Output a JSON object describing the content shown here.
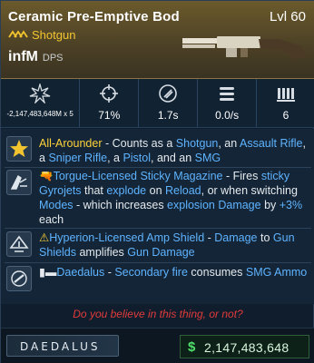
{
  "item": {
    "name": "Ceramic Pre-Emptive Bod",
    "level": "Lvl 60",
    "type": "Shotgun",
    "rarity_icon": "chevrons",
    "dps_value": "infM",
    "dps_label": "DPS"
  },
  "stats": [
    {
      "icon": "damage-burst-icon",
      "value": "-2,147,483,648M x 5"
    },
    {
      "icon": "crosshair-icon",
      "value": "71%"
    },
    {
      "icon": "reload-icon",
      "value": "1.7s"
    },
    {
      "icon": "fire-rate-icon",
      "value": "0.0/s"
    },
    {
      "icon": "magazine-icon",
      "value": "6"
    }
  ],
  "perks": [
    {
      "icon": "star-perk-icon",
      "parts": [
        {
          "t": "All-Arounder",
          "c": "hl"
        },
        {
          "t": " - Counts as a ",
          "c": ""
        },
        {
          "t": "Shotgun",
          "c": "bl"
        },
        {
          "t": ", an ",
          "c": ""
        },
        {
          "t": "Assault Rifle",
          "c": "bl"
        },
        {
          "t": ", a ",
          "c": ""
        },
        {
          "t": "Sniper Rifle",
          "c": "bl"
        },
        {
          "t": ", a ",
          "c": ""
        },
        {
          "t": "Pistol",
          "c": "bl"
        },
        {
          "t": ", and an ",
          "c": ""
        },
        {
          "t": "SMG",
          "c": "bl"
        }
      ]
    },
    {
      "icon": "sticky-magazine-icon",
      "parts": [
        {
          "t": "🔫",
          "c": ""
        },
        {
          "t": "Torgue-Licensed Sticky Magazine",
          "c": "bl"
        },
        {
          "t": " - Fires ",
          "c": ""
        },
        {
          "t": "sticky Gyrojets",
          "c": "bl"
        },
        {
          "t": " that ",
          "c": ""
        },
        {
          "t": "explode",
          "c": "bl"
        },
        {
          "t": " on ",
          "c": ""
        },
        {
          "t": "Reload",
          "c": "bl"
        },
        {
          "t": ", or when switching ",
          "c": ""
        },
        {
          "t": "Modes",
          "c": "bl"
        },
        {
          "t": " - which increases ",
          "c": ""
        },
        {
          "t": "explosion Damage",
          "c": "bl"
        },
        {
          "t": " by ",
          "c": ""
        },
        {
          "t": "+3%",
          "c": "bl"
        },
        {
          "t": " each",
          "c": ""
        }
      ]
    },
    {
      "icon": "amp-shield-icon",
      "parts": [
        {
          "t": "⚠",
          "c": "hl"
        },
        {
          "t": "Hyperion-Licensed Amp Shield",
          "c": "bl"
        },
        {
          "t": " - ",
          "c": ""
        },
        {
          "t": "Damage",
          "c": "bl"
        },
        {
          "t": " to ",
          "c": ""
        },
        {
          "t": "Gun Shields",
          "c": "bl"
        },
        {
          "t": " amplifies ",
          "c": ""
        },
        {
          "t": "Gun Damage",
          "c": "bl"
        }
      ]
    },
    {
      "icon": "secondary-fire-icon",
      "parts": [
        {
          "t": "▮▬",
          "c": ""
        },
        {
          "t": "Daedalus",
          "c": "bl"
        },
        {
          "t": " - ",
          "c": ""
        },
        {
          "t": "Secondary fire",
          "c": "bl"
        },
        {
          "t": " consumes ",
          "c": ""
        },
        {
          "t": "SMG Ammo",
          "c": "bl"
        }
      ]
    }
  ],
  "flavor": "Do you believe in this thing, or not?",
  "manufacturer": "DAEDALUS",
  "price": {
    "symbol": "$",
    "value": "2,147,483,648"
  },
  "colors": {
    "accent": "#f2c530",
    "keyword": "#5fb3ff",
    "flavor": "#e33b3b",
    "price": "#4fe06a"
  }
}
